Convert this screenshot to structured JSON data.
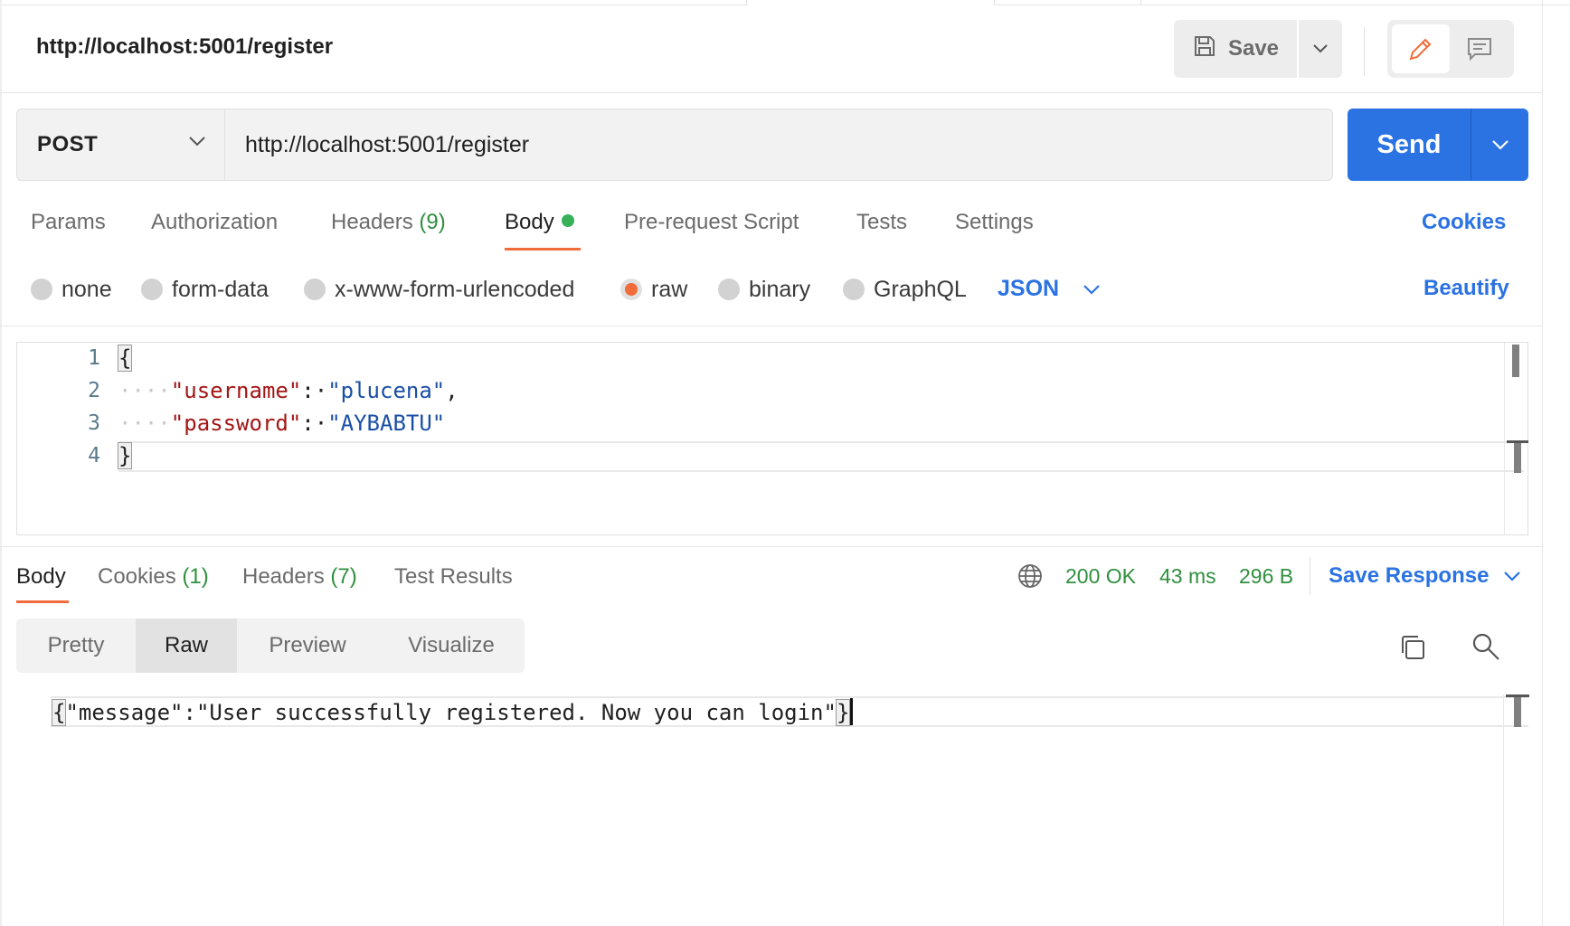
{
  "request": {
    "title": "http://localhost:5001/register",
    "save_label": "Save",
    "method": "POST",
    "url": "http://localhost:5001/register",
    "send_label": "Send"
  },
  "request_tabs": {
    "params": "Params",
    "authorization": "Authorization",
    "headers": "Headers",
    "headers_count": "(9)",
    "body": "Body",
    "pre_request": "Pre-request Script",
    "tests": "Tests",
    "settings": "Settings",
    "cookies": "Cookies"
  },
  "body_types": {
    "none": "none",
    "form_data": "form-data",
    "urlencoded": "x-www-form-urlencoded",
    "raw": "raw",
    "binary": "binary",
    "graphql": "GraphQL",
    "language": "JSON",
    "beautify": "Beautify",
    "selected": "raw"
  },
  "request_body": {
    "line_numbers": [
      "1",
      "2",
      "3",
      "4"
    ],
    "open_brace": "{",
    "close_brace": "}",
    "indent": "····",
    "key1": "\"username\"",
    "sep1": ":·",
    "val1": "\"plucena\"",
    "comma": ",",
    "key2": "\"password\"",
    "sep2": ":·",
    "val2": "\"AYBABTU\""
  },
  "response_tabs": {
    "body": "Body",
    "cookies": "Cookies",
    "cookies_count": "(1)",
    "headers": "Headers",
    "headers_count": "(7)",
    "test_results": "Test Results"
  },
  "response_meta": {
    "status": "200 OK",
    "time": "43 ms",
    "size": "296 B",
    "save_response": "Save Response"
  },
  "view_modes": {
    "pretty": "Pretty",
    "raw": "Raw",
    "preview": "Preview",
    "visualize": "Visualize",
    "selected": "Raw"
  },
  "response_body": {
    "open_brace": "{",
    "content": "\"message\":\"User successfully registered. Now you can login\"",
    "close_brace": "}"
  },
  "colors": {
    "accent": "#2b72e3",
    "tab_indicator": "#f26b3a",
    "status_ok": "#2f8f3f"
  }
}
